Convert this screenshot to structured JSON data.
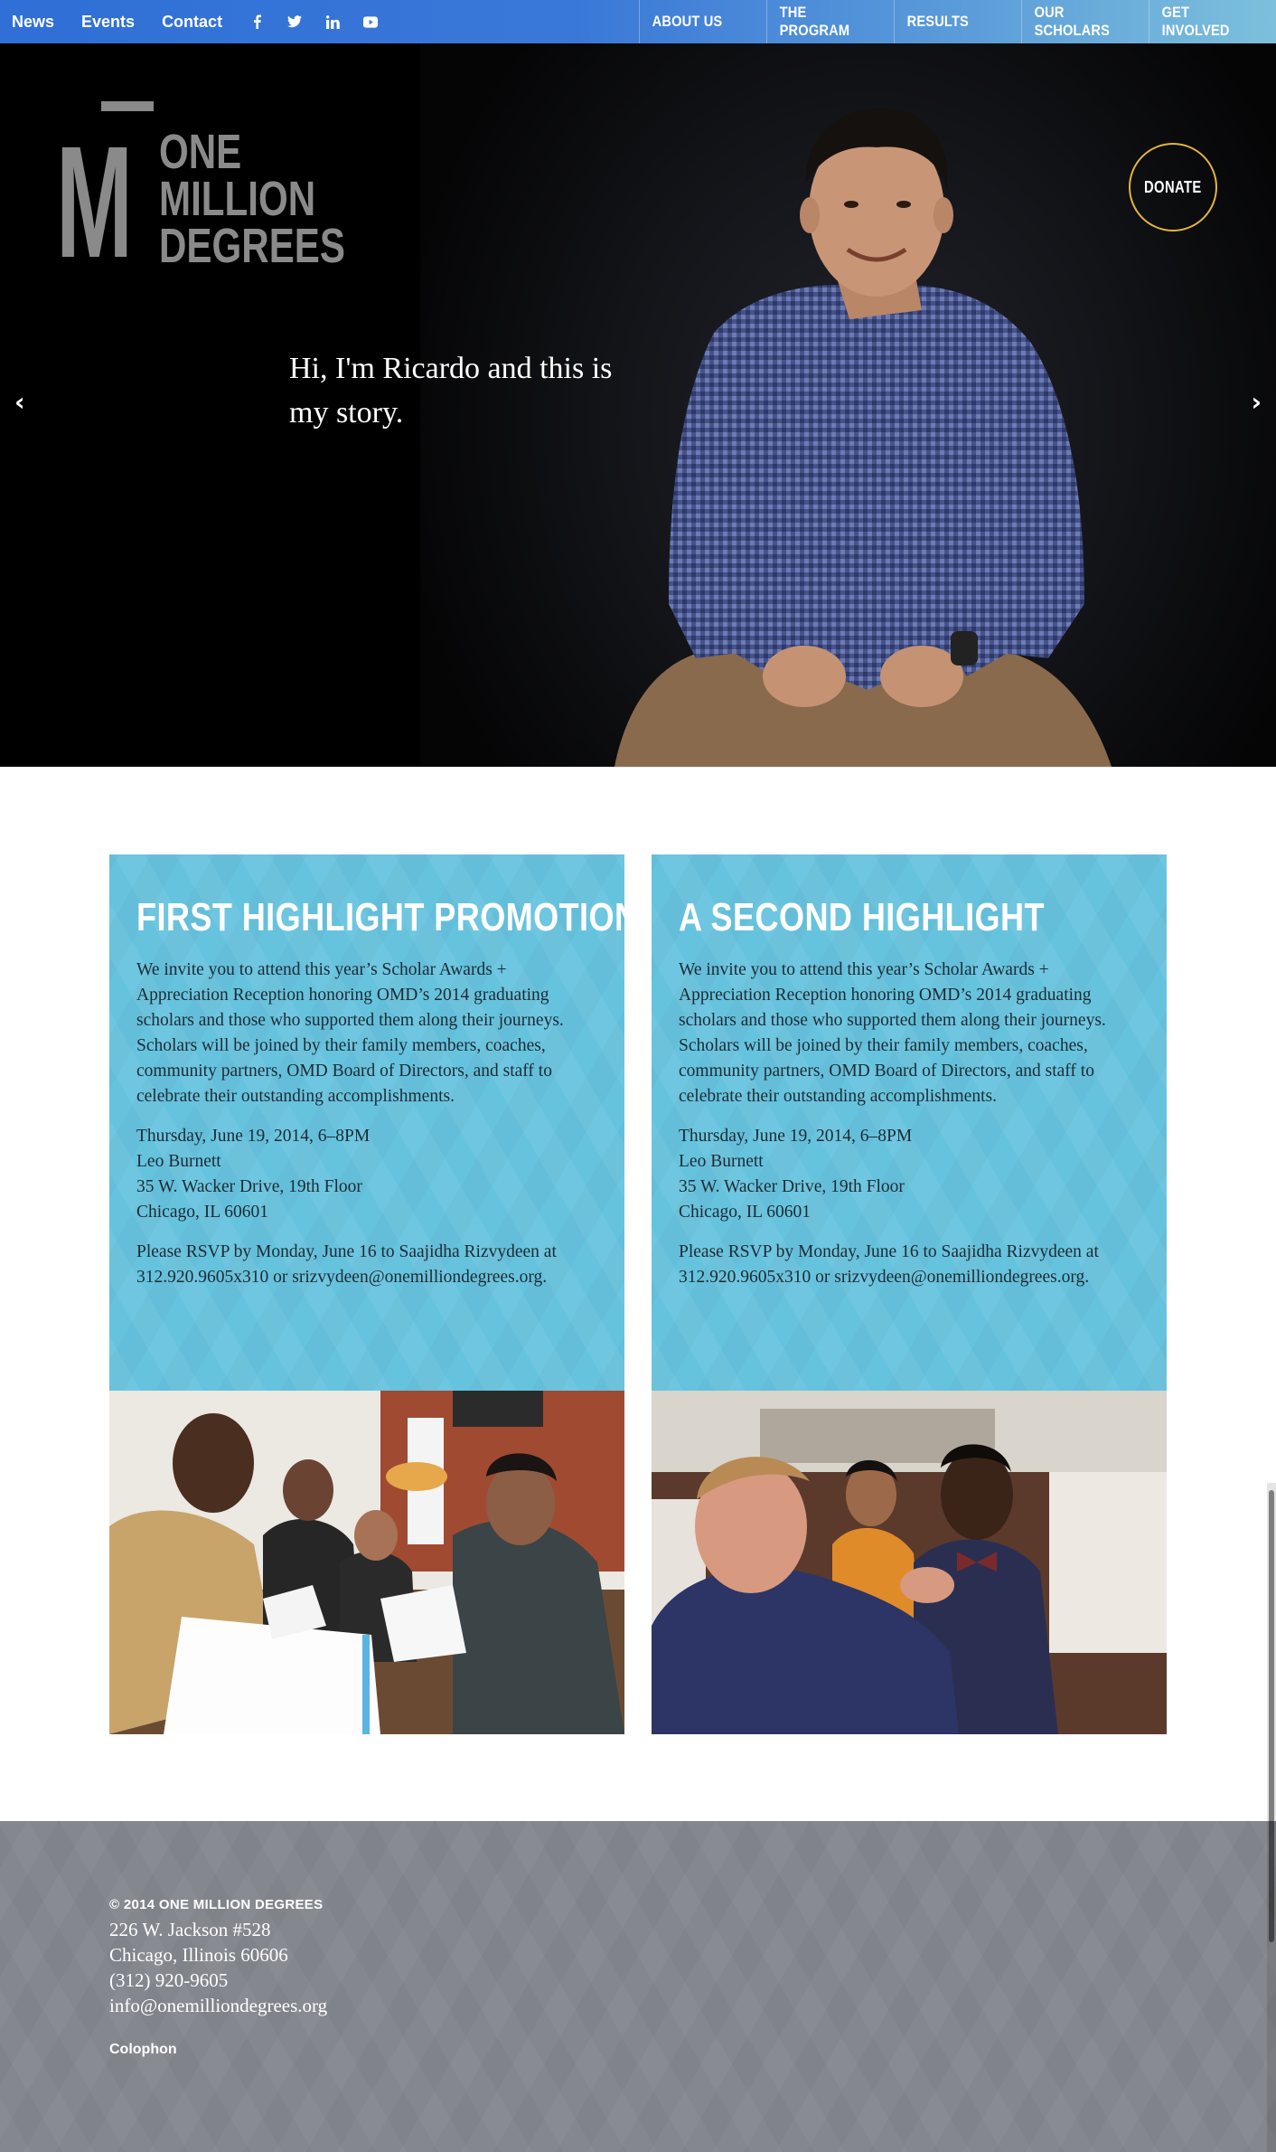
{
  "utility_nav": {
    "news": "News",
    "events": "Events",
    "contact": "Contact"
  },
  "social": [
    "facebook-icon",
    "twitter-icon",
    "linkedin-icon",
    "youtube-icon"
  ],
  "main_nav": {
    "about": "About Us",
    "program": "The Program",
    "results": "Results",
    "scholars": "Our Scholars",
    "involved": "Get Involved"
  },
  "logo": {
    "mark": "M",
    "line1": "ONE",
    "line2": "MILLION",
    "line3": "DEGREES"
  },
  "hero": {
    "tagline": "Hi, I'm Ricardo and this is my story.",
    "prev_arrow": "‹",
    "next_arrow": "›",
    "donate": "DONATE"
  },
  "promos": [
    {
      "title": "First Highlight Promotion",
      "body": "We invite you to attend this year’s Scholar Awards + Appreciation Reception honoring OMD’s 2014 graduating scholars and those who supported them along their journeys. Scholars will be joined by their family members, coaches, community partners, OMD Board of Directors, and staff to celebrate their outstanding accomplishments.",
      "event_date": "Thursday, June 19, 2014, 6–8PM",
      "venue": "Leo Burnett",
      "street": "35 W. Wacker Drive, 19th Floor",
      "city": "Chicago, IL 60601",
      "rsvp": "Please RSVP by Monday, June 16 to Saajidha Rizvydeen at 312.920.9605x310 or srizvydeen@onemilliondegrees.org."
    },
    {
      "title": "A Second Highlight",
      "body": "We invite you to attend this year’s Scholar Awards + Appreciation Reception honoring OMD’s 2014 graduating scholars and those who supported them along their journeys. Scholars will be joined by their family members, coaches, community partners, OMD Board of Directors, and staff to celebrate their outstanding accomplishments.",
      "event_date": "Thursday, June 19, 2014, 6–8PM",
      "venue": "Leo Burnett",
      "street": "35 W. Wacker Drive, 19th Floor",
      "city": "Chicago, IL 60601",
      "rsvp": "Please RSVP by Monday, June 16 to Saajidha Rizvydeen at 312.920.9605x310 or srizvydeen@onemilliondegrees.org."
    }
  ],
  "footer": {
    "copyright": "© 2014 ONE MILLION DEGREES",
    "address1": "226 W. Jackson #528",
    "address2": "Chicago, Illinois 60606",
    "phone": "(312) 920-9605",
    "email": "info@onemilliondegrees.org",
    "colophon": "Colophon"
  },
  "colors": {
    "nav_start": "#2f6fd6",
    "nav_end": "#7cc0dc",
    "promo_bg": "#66c3de",
    "footer_bg": "#85878e",
    "donate_ring": "#e3b53a"
  }
}
